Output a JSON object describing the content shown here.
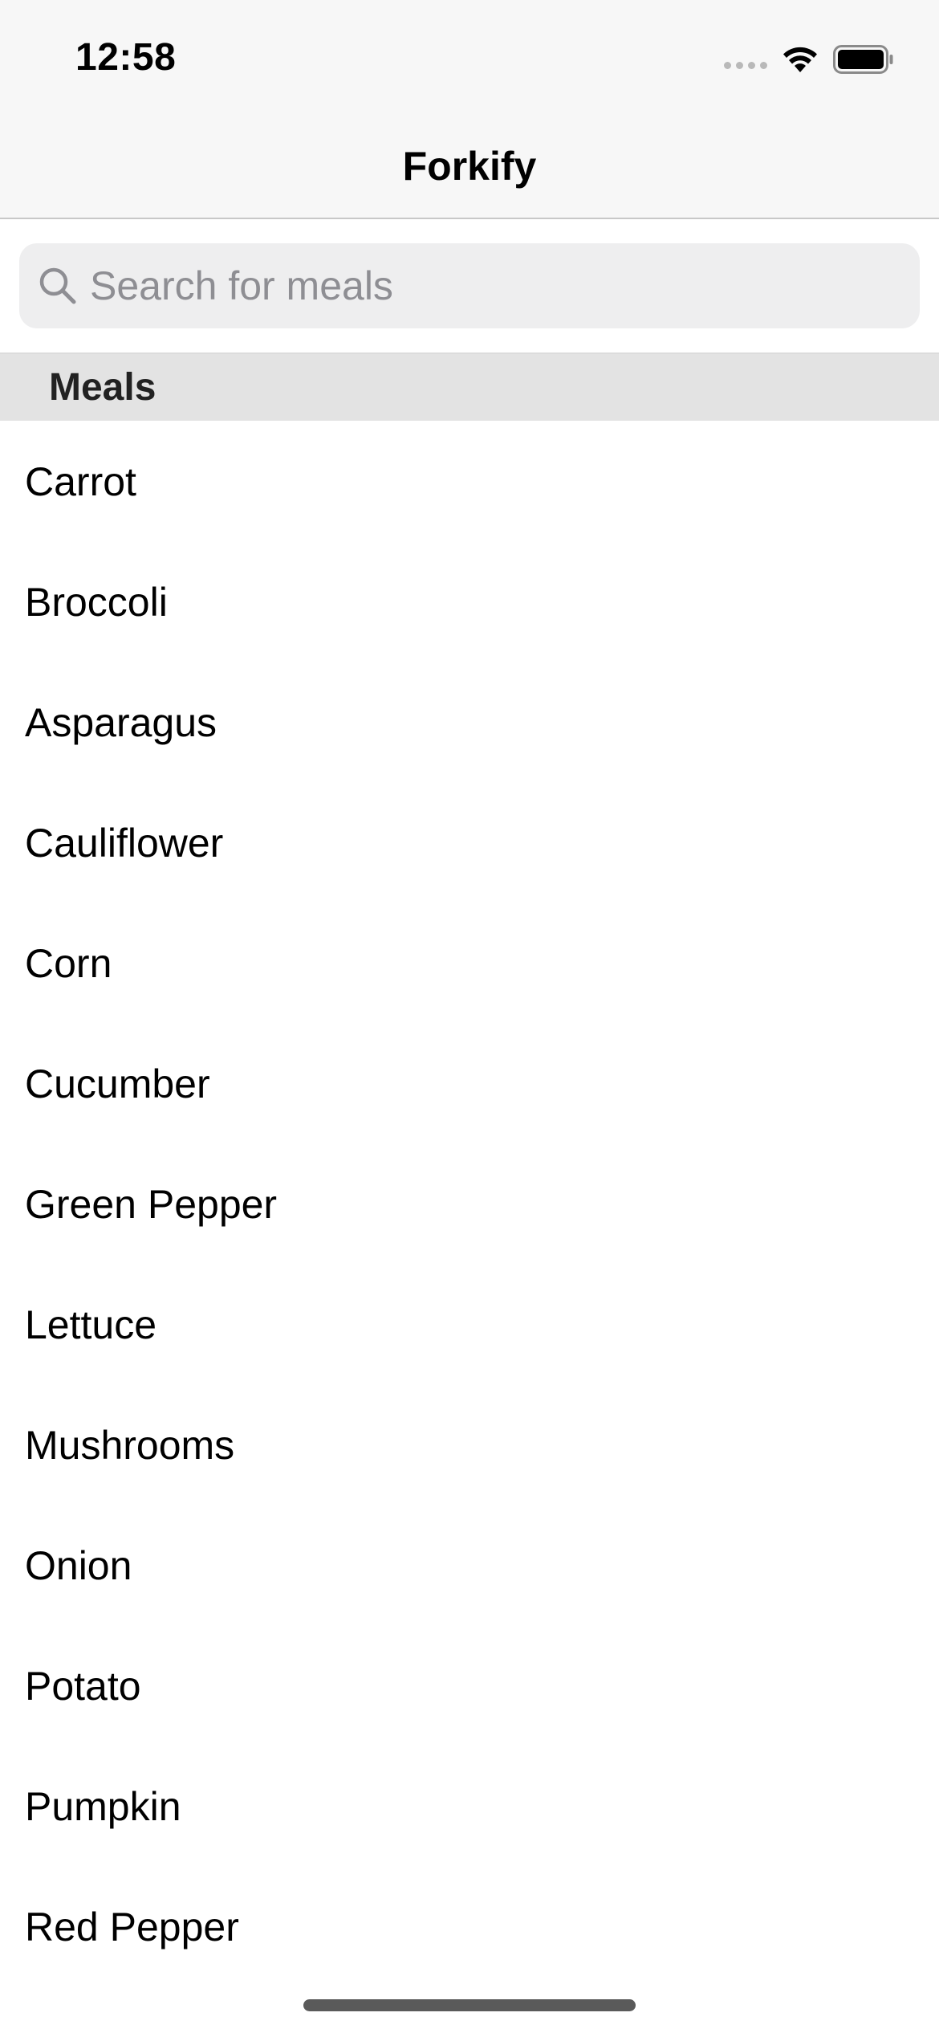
{
  "status_bar": {
    "time": "12:58"
  },
  "nav": {
    "title": "Forkify"
  },
  "search": {
    "placeholder": "Search for meals",
    "value": ""
  },
  "section": {
    "title": "Meals"
  },
  "meals": [
    {
      "label": "Carrot"
    },
    {
      "label": "Broccoli"
    },
    {
      "label": "Asparagus"
    },
    {
      "label": "Cauliflower"
    },
    {
      "label": "Corn"
    },
    {
      "label": "Cucumber"
    },
    {
      "label": "Green Pepper"
    },
    {
      "label": "Lettuce"
    },
    {
      "label": "Mushrooms"
    },
    {
      "label": "Onion"
    },
    {
      "label": "Potato"
    },
    {
      "label": "Pumpkin"
    },
    {
      "label": "Red Pepper"
    }
  ],
  "icons": {
    "signal": "cellular-signal-icon",
    "wifi": "wifi-icon",
    "battery": "battery-icon",
    "search": "search-icon"
  }
}
